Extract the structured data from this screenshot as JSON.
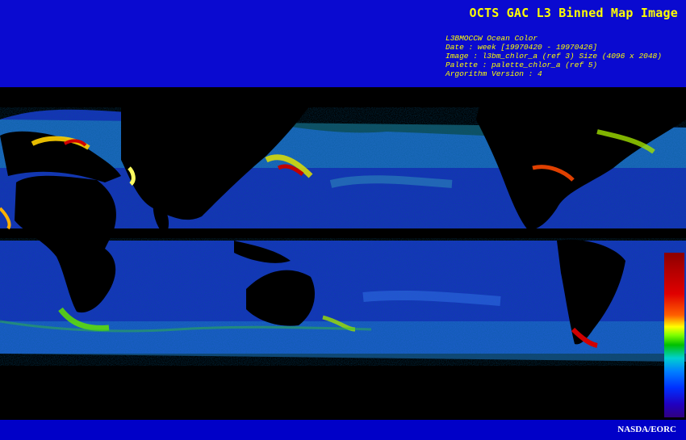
{
  "header": {
    "title": "OCTS GAC L3 Binned Map Image",
    "meta_lines": [
      "L3BMOCCW Ocean Color",
      "Date : week [19970420 - 19970426]",
      "Image : l3bm_chlor_a (ref 3) Size (4096 x 2048)",
      "Palette : palette_chlor_a (ref 5)",
      "Argorithm Version : 4"
    ]
  },
  "footer": {
    "credit": "NASDA/EORC"
  },
  "colors": {
    "background": "#0000c8",
    "title": "#ffff00",
    "map_bg": "#000000"
  },
  "map": {
    "description_free": true
  }
}
